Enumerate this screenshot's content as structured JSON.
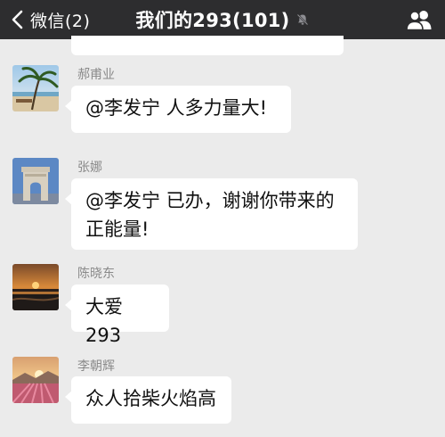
{
  "header": {
    "back_label": "微信(2)",
    "title": "我们的293(101)"
  },
  "messages": [
    {
      "sender": "郝甫业",
      "text": "@李发宁 人多力量大!"
    },
    {
      "sender": "张娜",
      "text_line1": "@李发宁 已办，谢谢你带来的",
      "text_line2": "正能量!"
    },
    {
      "sender": "陈晓东",
      "text": "大爱293"
    },
    {
      "sender": "李朝辉",
      "text": "众人拾柴火焰高"
    }
  ],
  "icons": {
    "back": "chevron-left-icon",
    "mute": "bell-muted-icon",
    "group": "group-members-icon"
  }
}
